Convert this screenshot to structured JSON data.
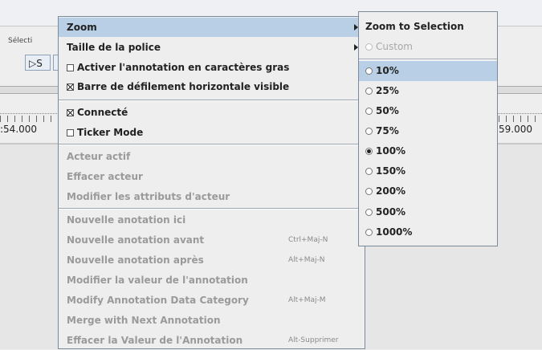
{
  "background": {
    "selection_label": "Sélecti",
    "selection_button": "▷S",
    "timeline_left": ":54.000",
    "timeline_right": "59.000"
  },
  "menu": {
    "zoom": "Zoom",
    "font_size": "Taille de la police",
    "bold_annotation": "Activer l'annotation en caractères gras",
    "horizontal_scrollbar": "Barre de défilement horizontale visible",
    "connected": "Connecté",
    "ticker_mode": "Ticker Mode",
    "active_actor": "Acteur actif",
    "clear_actor": "Effacer acteur",
    "modify_actor_attributes": "Modifier les attributs d'acteur",
    "new_annotation_here": "Nouvelle anotation ici",
    "new_annotation_before": "Nouvelle anotation avant",
    "new_annotation_before_shortcut": "Ctrl+Maj-N",
    "new_annotation_after": "Nouvelle anotation après",
    "new_annotation_after_shortcut": "Alt+Maj-N",
    "modify_annotation_value": "Modifier la valeur de l'annotation",
    "modify_data_category": "Modify Annotation Data Category",
    "modify_data_category_shortcut": "Alt+Maj-M",
    "merge_next": "Merge with Next Annotation",
    "clear_annotation_value": "Effacer la Valeur de l'Annotation",
    "clear_annotation_value_shortcut": "Alt-Supprimer",
    "checkbox_states": {
      "bold_annotation": false,
      "horizontal_scrollbar": true,
      "connected": true,
      "ticker_mode": false
    }
  },
  "submenu": {
    "zoom_to_selection": "Zoom to Selection",
    "custom": "Custom",
    "options": [
      "10%",
      "25%",
      "50%",
      "75%",
      "100%",
      "150%",
      "200%",
      "500%",
      "1000%"
    ],
    "selected": "100%",
    "highlighted": "10%"
  },
  "colors": {
    "highlight": "#b8cfe5",
    "menu_bg": "#eeeeee",
    "disabled_text": "#9a9a9a"
  }
}
